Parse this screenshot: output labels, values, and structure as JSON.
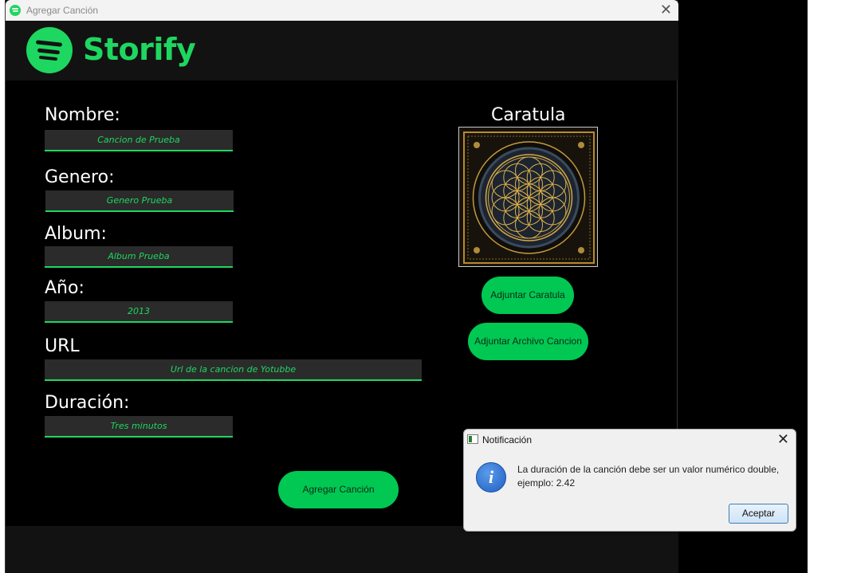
{
  "window": {
    "title": "Agregar Canción",
    "brand": "Storify"
  },
  "form": {
    "nombre": {
      "label": "Nombre:",
      "value": "Cancion de Prueba"
    },
    "genero": {
      "label": "Genero:",
      "value": "Genero Prueba"
    },
    "album": {
      "label": "Album:",
      "value": "Album Prueba"
    },
    "anio": {
      "label": "Año:",
      "value": "2013"
    },
    "url": {
      "label": "URL",
      "value": "Url de la cancion de Yotubbe"
    },
    "duracion": {
      "label": "Duración:",
      "value": "Tres minutos"
    },
    "submit_label": "Agregar Canción"
  },
  "cover": {
    "title": "Caratula",
    "attach_cover_label": "Adjuntar Caratula",
    "attach_song_label": "Adjuntar Archivo Cancion"
  },
  "dialog": {
    "title": "Notificación",
    "message": "La duración de la canción debe ser un valor numérico double, ejemplo: 2.42",
    "ok_label": "Aceptar"
  },
  "colors": {
    "accent": "#1ed760",
    "button": "#00c853",
    "background": "#000000",
    "field_bg": "#2b2b2b"
  }
}
